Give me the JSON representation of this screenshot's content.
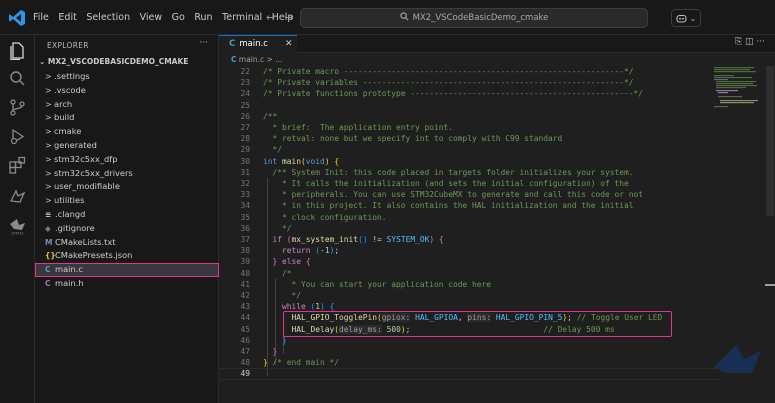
{
  "titlebar": {
    "menu": [
      "File",
      "Edit",
      "Selection",
      "View",
      "Go",
      "Run",
      "Terminal",
      "Help"
    ],
    "search_text": "MX2_VSCodeBasicDemo_cmake",
    "copilot_label": "⌄"
  },
  "activity_icons": [
    "explorer-icon",
    "search-icon",
    "source-control-icon",
    "run-debug-icon",
    "extensions-icon",
    "remote-explorer-icon",
    "stm32-icon"
  ],
  "sidebar": {
    "header": "EXPLORER",
    "more": "···",
    "project": "MX2_VSCODEBASICDEMO_CMAKE",
    "items": [
      {
        "label": ".settings",
        "kind": "folder"
      },
      {
        "label": ".vscode",
        "kind": "folder"
      },
      {
        "label": "arch",
        "kind": "folder"
      },
      {
        "label": "build",
        "kind": "folder"
      },
      {
        "label": "cmake",
        "kind": "folder"
      },
      {
        "label": "generated",
        "kind": "folder"
      },
      {
        "label": "stm32c5xx_dfp",
        "kind": "folder"
      },
      {
        "label": "stm32c5xx_drivers",
        "kind": "folder"
      },
      {
        "label": "user_modifiable",
        "kind": "folder"
      },
      {
        "label": "utilities",
        "kind": "folder"
      },
      {
        "label": ".clangd",
        "kind": "file",
        "icon": "≡",
        "icon_color": "#cccccc"
      },
      {
        "label": ".gitignore",
        "kind": "file",
        "icon": "◆",
        "icon_color": "#6d7a86"
      },
      {
        "label": "CMakeLists.txt",
        "kind": "file",
        "icon": "M",
        "icon_color": "#6f8eb5"
      },
      {
        "label": "CMakePresets.json",
        "kind": "file",
        "icon": "{}",
        "icon_color": "#cbcb41"
      },
      {
        "label": "main.c",
        "kind": "file",
        "icon": "C",
        "icon_color": "#519aba",
        "selected": true
      },
      {
        "label": "main.h",
        "kind": "file",
        "icon": "C",
        "icon_color": "#a074c4"
      }
    ]
  },
  "editor": {
    "tab_icon": "C",
    "tab_label": "main.c",
    "tab_close": "✕",
    "breadcrumb_icon": "C",
    "breadcrumb": "main.c > ...",
    "tab_actions": "⎘ ◫ ···",
    "lines": [
      {
        "n": "22",
        "s": [
          [
            "cm",
            "/* Private macro -----------------------------------------------------------*/"
          ]
        ]
      },
      {
        "n": "23",
        "s": [
          [
            "cm",
            "/* Private variables -------------------------------------------------------*/"
          ]
        ]
      },
      {
        "n": "24",
        "s": [
          [
            "cm",
            "/* Private functions prototype -----------------------------------------------*/"
          ]
        ]
      },
      {
        "n": "25",
        "s": []
      },
      {
        "n": "26",
        "s": [
          [
            "cm",
            "/**"
          ]
        ]
      },
      {
        "n": "27",
        "s": [
          [
            "cm",
            "  * brief:  The application entry point."
          ]
        ]
      },
      {
        "n": "28",
        "s": [
          [
            "cm",
            "  * retval: none but we specify int to comply with C99 standard"
          ]
        ]
      },
      {
        "n": "29",
        "s": [
          [
            "cm",
            "  */"
          ]
        ]
      },
      {
        "n": "30",
        "s": [
          [
            "kw",
            "int "
          ],
          [
            "fn",
            "main"
          ],
          [
            "brk1",
            "("
          ],
          [
            "kw",
            "void"
          ],
          [
            "brk1",
            ")"
          ],
          [
            "pl",
            " "
          ],
          [
            "brk1",
            "{"
          ]
        ]
      },
      {
        "n": "31",
        "s": [
          [
            "cm",
            "  /** System Init: this code placed in targets folder initializes your system."
          ]
        ]
      },
      {
        "n": "32",
        "s": [
          [
            "cm",
            "    * It calls the initialization (and sets the initial configuration) of the"
          ]
        ]
      },
      {
        "n": "33",
        "s": [
          [
            "cm",
            "    * peripherals. You can use STM32CubeMX to generate and call this code or not"
          ]
        ]
      },
      {
        "n": "34",
        "s": [
          [
            "cm",
            "    * in this project. It also contains the HAL initialization and the initial"
          ]
        ]
      },
      {
        "n": "35",
        "s": [
          [
            "cm",
            "    * clock configuration."
          ]
        ]
      },
      {
        "n": "36",
        "s": [
          [
            "cm",
            "    */"
          ]
        ]
      },
      {
        "n": "37",
        "s": [
          [
            "pl",
            "  "
          ],
          [
            "ctl",
            "if "
          ],
          [
            "brk2",
            "("
          ],
          [
            "fn",
            "mx_system_init"
          ],
          [
            "brk3",
            "()"
          ],
          [
            "pl",
            " != "
          ],
          [
            "mac",
            "SYSTEM_OK"
          ],
          [
            "brk2",
            ")"
          ],
          [
            "pl",
            " "
          ],
          [
            "brk2",
            "{"
          ]
        ]
      },
      {
        "n": "38",
        "s": [
          [
            "pl",
            "    "
          ],
          [
            "ctl",
            "return "
          ],
          [
            "brk3",
            "("
          ],
          [
            "pl",
            "-"
          ],
          [
            "num",
            "1"
          ],
          [
            "brk3",
            ")"
          ],
          [
            "pl",
            ";"
          ]
        ]
      },
      {
        "n": "39",
        "s": [
          [
            "pl",
            "  "
          ],
          [
            "brk2",
            "}"
          ],
          [
            "pl",
            " "
          ],
          [
            "ctl",
            "else "
          ],
          [
            "brk2",
            "{"
          ]
        ]
      },
      {
        "n": "40",
        "s": [
          [
            "cm",
            "    /*"
          ]
        ]
      },
      {
        "n": "41",
        "s": [
          [
            "cm",
            "      * You can start your application code here"
          ]
        ]
      },
      {
        "n": "42",
        "s": [
          [
            "cm",
            "      */"
          ]
        ]
      },
      {
        "n": "43",
        "s": [
          [
            "pl",
            "    "
          ],
          [
            "ctl",
            "while "
          ],
          [
            "brk3",
            "("
          ],
          [
            "num",
            "1"
          ],
          [
            "brk3",
            ")"
          ],
          [
            "pl",
            " "
          ],
          [
            "brk3",
            "{"
          ]
        ]
      },
      {
        "n": "44",
        "s": [
          [
            "pl",
            "      "
          ],
          [
            "fn",
            "HAL_GPIO_TogglePin"
          ],
          [
            "brk1",
            "("
          ],
          [
            "hint",
            "gpiox:"
          ],
          [
            "pl",
            " "
          ],
          [
            "mac",
            "HAL_GPIOA"
          ],
          [
            "pl",
            ", "
          ],
          [
            "hint",
            "pins:"
          ],
          [
            "pl",
            " "
          ],
          [
            "mac",
            "HAL_GPIO_PIN_5"
          ],
          [
            "brk1",
            ")"
          ],
          [
            "pl",
            "; "
          ],
          [
            "cm",
            "// Toggle User LED"
          ]
        ]
      },
      {
        "n": "45",
        "s": [
          [
            "pl",
            "      "
          ],
          [
            "fn",
            "HAL_Delay"
          ],
          [
            "brk1",
            "("
          ],
          [
            "hint",
            "delay_ms:"
          ],
          [
            "pl",
            " "
          ],
          [
            "num",
            "500"
          ],
          [
            "brk1",
            ")"
          ],
          [
            "pl",
            ";                            "
          ],
          [
            "cm",
            "// Delay 500 ms"
          ]
        ]
      },
      {
        "n": "46",
        "s": [
          [
            "pl",
            "    "
          ],
          [
            "brk3",
            "}"
          ]
        ]
      },
      {
        "n": "47",
        "s": [
          [
            "pl",
            "  "
          ],
          [
            "brk2",
            "}"
          ]
        ]
      },
      {
        "n": "48",
        "s": [
          [
            "brk1",
            "}"
          ],
          [
            "pl",
            " "
          ],
          [
            "cm",
            "/* end main */"
          ]
        ]
      },
      {
        "n": "49",
        "s": [],
        "current": true
      }
    ]
  }
}
